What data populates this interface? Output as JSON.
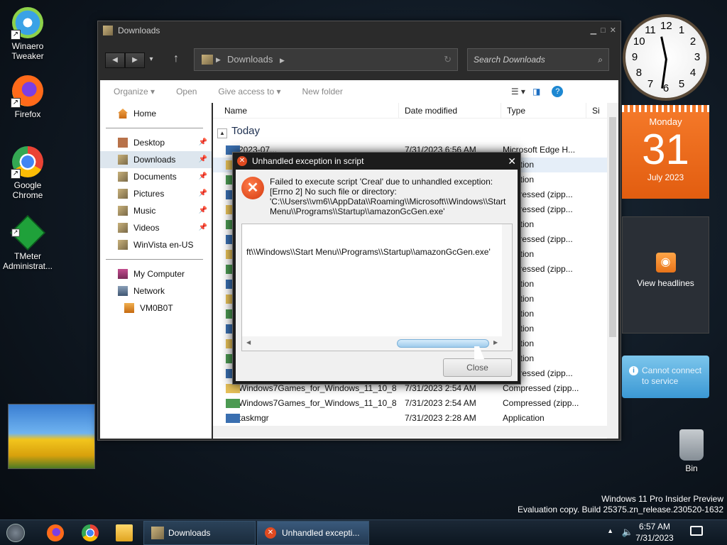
{
  "desktop": {
    "icons": [
      {
        "label_line1": "Winaero",
        "label_line2": "Tweaker"
      },
      {
        "label_line1": "Firefox",
        "label_line2": ""
      },
      {
        "label_line1": "Google",
        "label_line2": "Chrome"
      },
      {
        "label_line1": "TMeter",
        "label_line2": "Administrat..."
      }
    ],
    "bin_label": "Bin",
    "watermark_line1": "Windows 11 Pro Insider Preview",
    "watermark_line2": "Evaluation copy. Build 25375.zn_release.230520-1632"
  },
  "explorer": {
    "title": "Downloads",
    "address": "Downloads",
    "search_placeholder": "Search Downloads",
    "toolbar": {
      "organize": "Organize",
      "open": "Open",
      "give_access": "Give access to",
      "new_folder": "New folder"
    },
    "nav": {
      "home": "Home",
      "desktop": "Desktop",
      "downloads": "Downloads",
      "documents": "Documents",
      "pictures": "Pictures",
      "music": "Music",
      "videos": "Videos",
      "winvista": "WinVista en-US",
      "my_computer": "My Computer",
      "network": "Network",
      "vm": "VM0B0T"
    },
    "columns": {
      "name": "Name",
      "date": "Date modified",
      "type": "Type",
      "size": "Si"
    },
    "group": "Today",
    "rows": [
      {
        "name": "2023-07...",
        "date": "7/31/2023 6:56 AM",
        "type": "Microsoft Edge H..."
      },
      {
        "name": "",
        "date": "",
        "type": "plication"
      },
      {
        "name": "",
        "date": "",
        "type": "plication"
      },
      {
        "name": "",
        "date": "",
        "type": "ompressed (zipp..."
      },
      {
        "name": "",
        "date": "",
        "type": "ompressed (zipp..."
      },
      {
        "name": "",
        "date": "",
        "type": "plication"
      },
      {
        "name": "",
        "date": "",
        "type": "ompressed (zipp..."
      },
      {
        "name": "",
        "date": "",
        "type": "plication"
      },
      {
        "name": "",
        "date": "",
        "type": "ompressed (zipp..."
      },
      {
        "name": "",
        "date": "",
        "type": "plication"
      },
      {
        "name": "",
        "date": "",
        "type": "plication"
      },
      {
        "name": "",
        "date": "",
        "type": "plication"
      },
      {
        "name": "",
        "date": "",
        "type": "plication"
      },
      {
        "name": "",
        "date": "",
        "type": "plication"
      },
      {
        "name": "",
        "date": "",
        "type": "plication"
      },
      {
        "name": "",
        "date": "",
        "type": "ompressed (zipp..."
      },
      {
        "name": "Windows7Games_for_Windows_11_10_8 (...",
        "date": "7/31/2023 2:54 AM",
        "type": "Compressed (zipp..."
      },
      {
        "name": "Windows7Games_for_Windows_11_10_8",
        "date": "7/31/2023 2:54 AM",
        "type": "Compressed (zipp..."
      },
      {
        "name": "taskmgr",
        "date": "7/31/2023 2:28 AM",
        "type": "Application"
      }
    ]
  },
  "dialog": {
    "title": "Unhandled exception in script",
    "message": "Failed to execute script 'Creal' due to unhandled exception:\n[Errno 2] No such file or directory:\n'C:\\\\Users\\\\vm6\\\\AppData\\\\Roaming\\\\Microsoft\\\\Windows\\\\Start\nMenu\\\\Programs\\\\Startup\\\\amazonGcGen.exe'",
    "traceback_line": "ft\\\\Windows\\\\Start Menu\\\\Programs\\\\Startup\\\\amazonGcGen.exe'",
    "close_label": "Close"
  },
  "gadgets": {
    "clock_numbers": [
      "12",
      "1",
      "2",
      "3",
      "4",
      "5",
      "6",
      "7",
      "8",
      "9",
      "10",
      "11"
    ],
    "calendar": {
      "weekday": "Monday",
      "day": "31",
      "month_year": "July 2023"
    },
    "rss_label": "View headlines",
    "weather_line1": "Cannot connect",
    "weather_line2": "to service"
  },
  "taskbar": {
    "tasks": [
      {
        "label": "Downloads"
      },
      {
        "label": "Unhandled excepti..."
      }
    ],
    "time": "6:57 AM",
    "date": "7/31/2023"
  }
}
